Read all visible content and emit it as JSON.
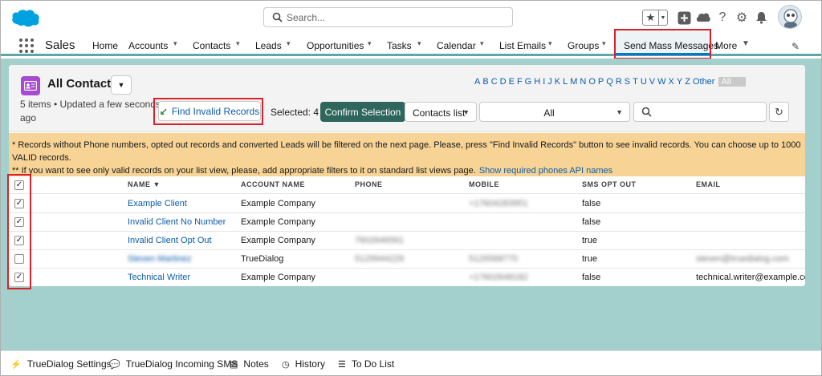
{
  "header": {
    "search_placeholder": "Search...",
    "favorites_icon": "star-icon",
    "icons": [
      "plus-icon",
      "cloud-icon",
      "help-icon",
      "gear-icon",
      "bell-icon",
      "avatar"
    ]
  },
  "nav": {
    "app_name": "Sales",
    "items": [
      {
        "label": "Home"
      },
      {
        "label": "Accounts"
      },
      {
        "label": "Contacts"
      },
      {
        "label": "Leads"
      },
      {
        "label": "Opportunities"
      },
      {
        "label": "Tasks"
      },
      {
        "label": "Calendar"
      },
      {
        "label": "List Emails"
      },
      {
        "label": "Groups"
      },
      {
        "label": "Send Mass Messages"
      },
      {
        "label": "More"
      }
    ]
  },
  "list": {
    "title": "All Contacts",
    "meta": "5 items • Updated a few seconds ago",
    "find_button": "Find Invalid Records",
    "selected_text": "Selected: 4",
    "confirm_button": "Confirm Selection",
    "list_select": "Contacts list",
    "filter_select": "All",
    "alphabet": [
      "A",
      "B",
      "C",
      "D",
      "E",
      "F",
      "G",
      "H",
      "I",
      "J",
      "K",
      "L",
      "M",
      "N",
      "O",
      "P",
      "Q",
      "R",
      "S",
      "T",
      "U",
      "V",
      "W",
      "X",
      "Y",
      "Z",
      "Other",
      "All"
    ]
  },
  "notice": {
    "line1": "* Records without Phone numbers, opted out records and converted Leads will be filtered on the next page. Please, press \"Find Invalid Records\" button to see invalid records. You can choose up to 1000 VALID records.",
    "line2": "** If you want to see only valid records on your list view, please, add appropriate filters to it on standard list views page.",
    "link": "Show required phones API names"
  },
  "table": {
    "columns": [
      "NAME ▼",
      "ACCOUNT NAME",
      "PHONE",
      "MOBILE",
      "SMS OPT OUT",
      "EMAIL"
    ],
    "rows": [
      {
        "checked": "✓",
        "name": "Example Client",
        "account": "Example Company",
        "phone": "",
        "mobile": "+17604283951",
        "sms_opt_out": "false",
        "email": ""
      },
      {
        "checked": "✓",
        "name": "Invalid Client No Number",
        "account": "Example Company",
        "phone": "",
        "mobile": "",
        "sms_opt_out": "false",
        "email": ""
      },
      {
        "checked": "✓",
        "name": "Invalid Client Opt Out",
        "account": "Example Company",
        "phone": "7602646561",
        "mobile": "",
        "sms_opt_out": "true",
        "email": ""
      },
      {
        "checked": "",
        "name": "Steven Martinez",
        "account": "TrueDialog",
        "phone": "5129944229",
        "mobile": "5126568770",
        "sms_opt_out": "true",
        "email": "steven@truedialog.com"
      },
      {
        "checked": "✓",
        "name": "Technical Writer",
        "account": "Example Company",
        "phone": "",
        "mobile": "+17602648182",
        "sms_opt_out": "false",
        "email": "technical.writer@example.com"
      }
    ]
  },
  "footer": {
    "items": [
      {
        "label": "TrueDialog Settings",
        "icon": "bolt-icon"
      },
      {
        "label": "TrueDialog Incoming SMS",
        "icon": "chat-icon"
      },
      {
        "label": "Notes",
        "icon": "note-icon"
      },
      {
        "label": "History",
        "icon": "clock-icon"
      },
      {
        "label": "To Do List",
        "icon": "checklist-icon"
      }
    ]
  },
  "colors": {
    "accent": "#0176d3",
    "teal_bg": "#a3cfcc",
    "confirm": "#2e665e",
    "highlight_box": "#d8212b",
    "notice_bg": "#f7d496"
  }
}
